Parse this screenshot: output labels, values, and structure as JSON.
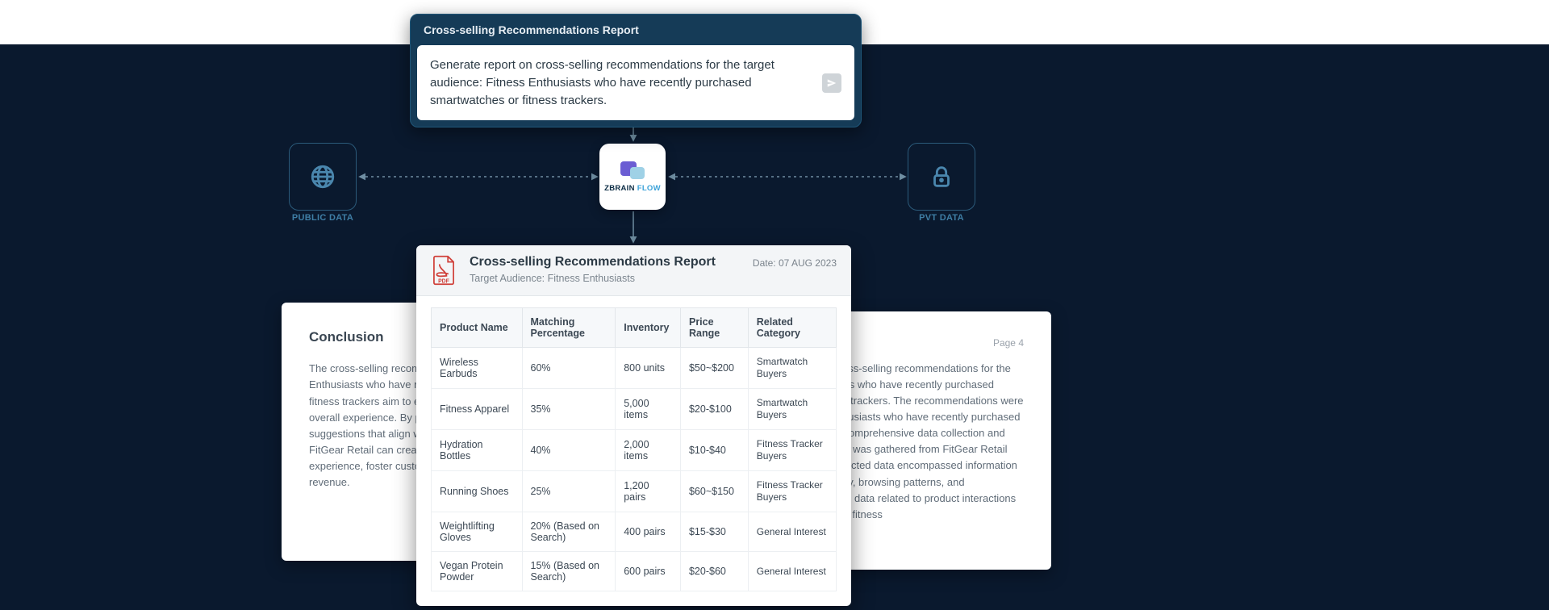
{
  "prompt_card": {
    "title": "Cross-selling Recommendations Report",
    "body": "Generate report on cross-selling recommendations for the target audience: Fitness Enthusiasts who have recently purchased smartwatches or fitness trackers."
  },
  "tiles": {
    "public_label": "PUBLIC DATA",
    "pvt_label": "PVT DATA"
  },
  "zbrain": {
    "brand1": "ZBRAIN",
    "brand2": " FLOW"
  },
  "doc_left": {
    "heading": "Conclusion",
    "text": "The cross-selling recommendations for Fitness Enthusiasts who have recently purchased smartwatches or fitness trackers aim to enhance their fitness journey and overall experience. By providing tailored product suggestions that align with their needs and preferences, FitGear Retail can create a more engaging shopping experience, foster customer loyalty, and drive increased revenue."
  },
  "doc_right": {
    "page_label": "Page 4",
    "text": "This report presents cross-selling recommendations for the target audience of fitness who have recently purchased smartwatches or fitness trackers. The recommendations were derived for Fitness Enthusiasts who have recently purchased smartwatches through comprehensive data collection and analysis. Customer data was gathered from FitGear Retail Inc.'s systems. The collected data encompassed information such as purchase history, browsing patterns, and timestamps. Specifically, data related to product interactions and interests relevant to fitness"
  },
  "report": {
    "title": "Cross-selling Recommendations Report",
    "subtitle": "Target Audience: Fitness Enthusiasts",
    "date": "Date: 07 AUG 2023",
    "columns": {
      "c0": "Product Name",
      "c1": "Matching Percentage",
      "c2": "Inventory",
      "c3": "Price Range",
      "c4": "Related Category"
    },
    "rows": [
      {
        "name": "Wireless Earbuds",
        "match": "60%",
        "inv": "800 units",
        "price": "$50~$200",
        "cat": "Smartwatch Buyers"
      },
      {
        "name": "Fitness Apparel",
        "match": "35%",
        "inv": "5,000 items",
        "price": "$20-$100",
        "cat": "Smartwatch Buyers"
      },
      {
        "name": "Hydration Bottles",
        "match": "40%",
        "inv": "2,000 items",
        "price": "$10-$40",
        "cat": "Fitness Tracker Buyers"
      },
      {
        "name": "Running Shoes",
        "match": "25%",
        "inv": "1,200 pairs",
        "price": "$60~$150",
        "cat": "Fitness Tracker Buyers"
      },
      {
        "name": "Weightlifting Gloves",
        "match": "20% (Based on Search)",
        "inv": "400 pairs",
        "price": "$15-$30",
        "cat": "General Interest"
      },
      {
        "name": "Vegan Protein Powder",
        "match": "15% (Based on Search)",
        "inv": "600 pairs",
        "price": "$20-$60",
        "cat": "General Interest"
      }
    ]
  },
  "chart_data": {
    "type": "table",
    "title": "Cross-selling Recommendations Report",
    "columns": [
      "Product Name",
      "Matching Percentage",
      "Inventory",
      "Price Range",
      "Related Category"
    ],
    "rows": [
      [
        "Wireless Earbuds",
        "60%",
        "800 units",
        "$50~$200",
        "Smartwatch Buyers"
      ],
      [
        "Fitness Apparel",
        "35%",
        "5,000 items",
        "$20-$100",
        "Smartwatch Buyers"
      ],
      [
        "Hydration Bottles",
        "40%",
        "2,000 items",
        "$10-$40",
        "Fitness Tracker Buyers"
      ],
      [
        "Running Shoes",
        "25%",
        "1,200 pairs",
        "$60~$150",
        "Fitness Tracker Buyers"
      ],
      [
        "Weightlifting Gloves",
        "20% (Based on Search)",
        "400 pairs",
        "$15-$30",
        "General Interest"
      ],
      [
        "Vegan Protein Powder",
        "15% (Based on Search)",
        "600 pairs",
        "$20-$60",
        "General Interest"
      ]
    ]
  }
}
